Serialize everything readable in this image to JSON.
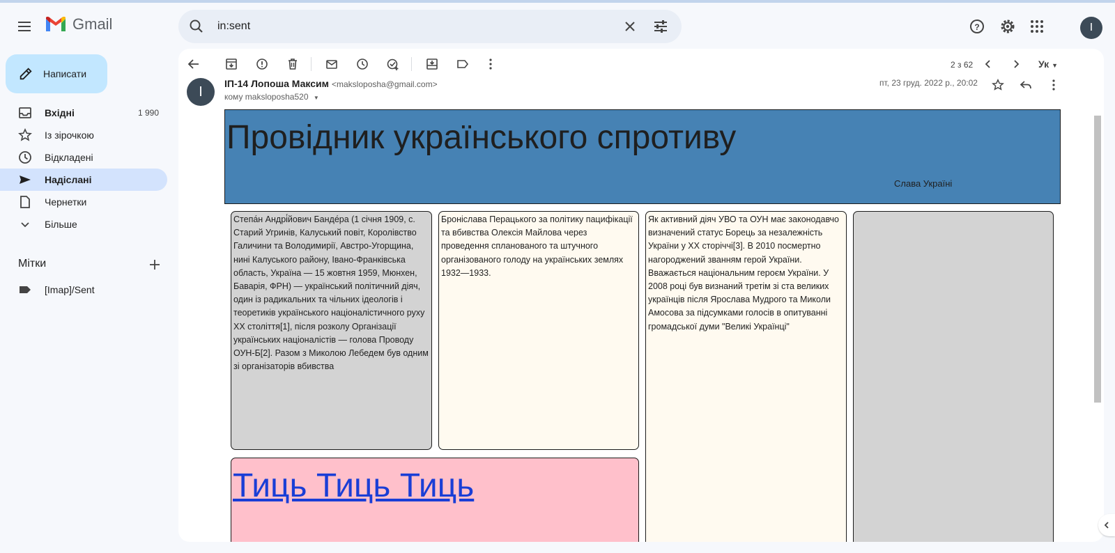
{
  "app": {
    "name": "Gmail"
  },
  "search": {
    "value": "in:sent"
  },
  "compose": {
    "label": "Написати"
  },
  "sidebar": {
    "items": [
      {
        "label": "Вхідні",
        "count": "1 990",
        "icon": "inbox-icon"
      },
      {
        "label": "Із зірочкою",
        "count": "",
        "icon": "star-icon"
      },
      {
        "label": "Відкладені",
        "count": "",
        "icon": "clock-icon"
      },
      {
        "label": "Надіслані",
        "count": "",
        "icon": "send-icon"
      },
      {
        "label": "Чернетки",
        "count": "",
        "icon": "draft-icon"
      },
      {
        "label": "Більше",
        "count": "",
        "icon": "chevron-down-icon"
      }
    ],
    "labels_heading": "Мітки",
    "labels": [
      {
        "label": "[Imap]/Sent",
        "icon": "label-icon"
      }
    ]
  },
  "user": {
    "avatar_letter": "I"
  },
  "toolbar": {
    "pager": "2 з 62",
    "input_lang": "Ук"
  },
  "message": {
    "sender_name": "ІП-14 Лопоша Максим",
    "sender_email": "<maksloposha@gmail.com>",
    "to": "кому maksloposha520",
    "date": "пт, 23 груд. 2022 р., 20:02",
    "avatar_letter": "I"
  },
  "email_body": {
    "title": "Провідник українського спротиву",
    "subtitle": "Слава Україні",
    "box1": "Степа́н Андрі́йович Банде́ра (1 січня 1909, с. Старий Угринів, Калуський повіт, Королівство Галичини та Володимирії, Австро-Угорщина, нині Калуського району, Івано-Франківська область, Україна — 15 жовтня 1959, Мюнхен, Баварія, ФРН) — український політичний діяч, один із радикальних та чільних ідеологів і теоретиків українського націоналістичного руху XX століття[1], після розколу Організації українських націоналістів — голова Проводу ОУН-Б[2]. Разом з Миколою Лебедем був одним зі організаторів вбивства",
    "box2": "Броніслава Перацького за політику пацифікації та вбивства Олексія Майлова через проведення спланованого та штучного організованого голоду на українських землях 1932—1933.",
    "box3": "Як активний діяч УВО та ОУН має законодавчо визначений статус Борець за незалежність України у XX сторіччі[3]. В 2010 посмертно нагороджений званням герой України. Вважається національним героєм України. У 2008 році був визнаний третім зі ста великих українців після Ярослава Мудрого та Миколи Амосова за підсумками голосів в опитуванні громадської думи \"Великі Українці\"",
    "link": "Тиць Тиць Тиць"
  },
  "colors": {
    "banner": "#4682b4",
    "box_gray": "#d3d3d3",
    "box_cream": "#fffaf0",
    "box_pink": "#ffc0cb",
    "active_nav": "#d3e3fd",
    "compose_bg": "#c2e7ff"
  }
}
